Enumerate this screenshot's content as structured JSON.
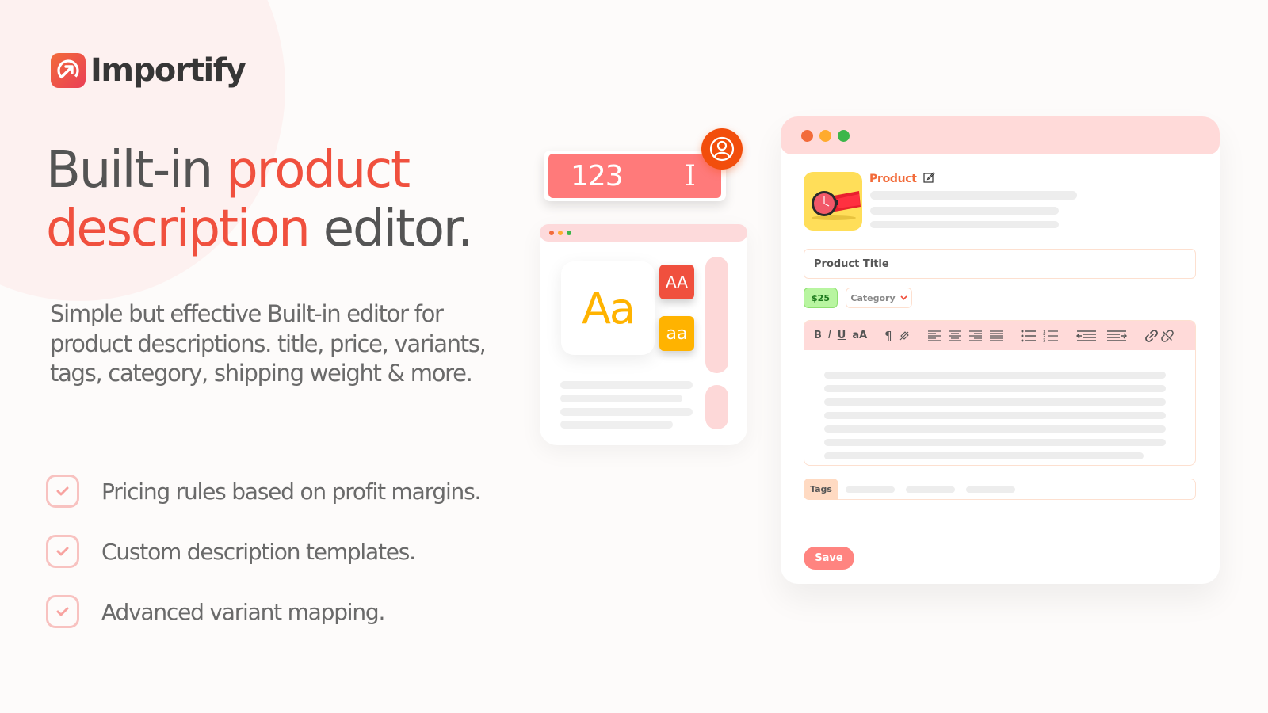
{
  "brand": {
    "name": "Importify",
    "logo_icon": "arrow-up-right-in-circle-icon",
    "accent_color": "#f0503e",
    "logo_gradient": [
      "#f26b3a",
      "#ea3f56"
    ]
  },
  "hero": {
    "headline_part1": "Built-in ",
    "headline_accent1": "product",
    "headline_accent2": "description",
    "headline_part2": " editor.",
    "subtext": "Simple but effective Built-in editor for product descriptions. title, price, variants, tags, category, shipping weight & more."
  },
  "features": [
    {
      "icon": "check-square-icon",
      "label": "Pricing rules based on profit margins."
    },
    {
      "icon": "check-square-icon",
      "label": "Custom description templates."
    },
    {
      "icon": "check-square-icon",
      "label": "Advanced variant mapping."
    }
  ],
  "number_input": {
    "value": "123",
    "cursor_icon": "text-cursor-icon",
    "badge_icon": "user-circle-icon"
  },
  "typography_window": {
    "window_dots": [
      "#f26b3a",
      "#ffab2e",
      "#3cb64a"
    ],
    "sample_text": "Aa",
    "uppercase_label": "AA",
    "lowercase_label": "aa"
  },
  "editor": {
    "window_dots": [
      "#f26b3a",
      "#ffab2e",
      "#3cb64a"
    ],
    "product_label": "Product",
    "product_edit_icon": "edit-icon",
    "product_image": "red-wristwatch",
    "title_field": "Product Title",
    "price": "$25",
    "category_label": "Category",
    "toolbar": {
      "bold": "B",
      "italic": "I",
      "underline": "U",
      "case": "aA",
      "tools": [
        "paragraph-icon",
        "clear-format-icon",
        "align-left-icon",
        "align-center-icon",
        "align-right-icon",
        "align-justify-icon",
        "bullet-list-icon",
        "numbered-list-icon",
        "outdent-icon",
        "indent-icon",
        "link-icon",
        "unlink-icon"
      ]
    },
    "tags_label": "Tags",
    "save_label": "Save"
  }
}
